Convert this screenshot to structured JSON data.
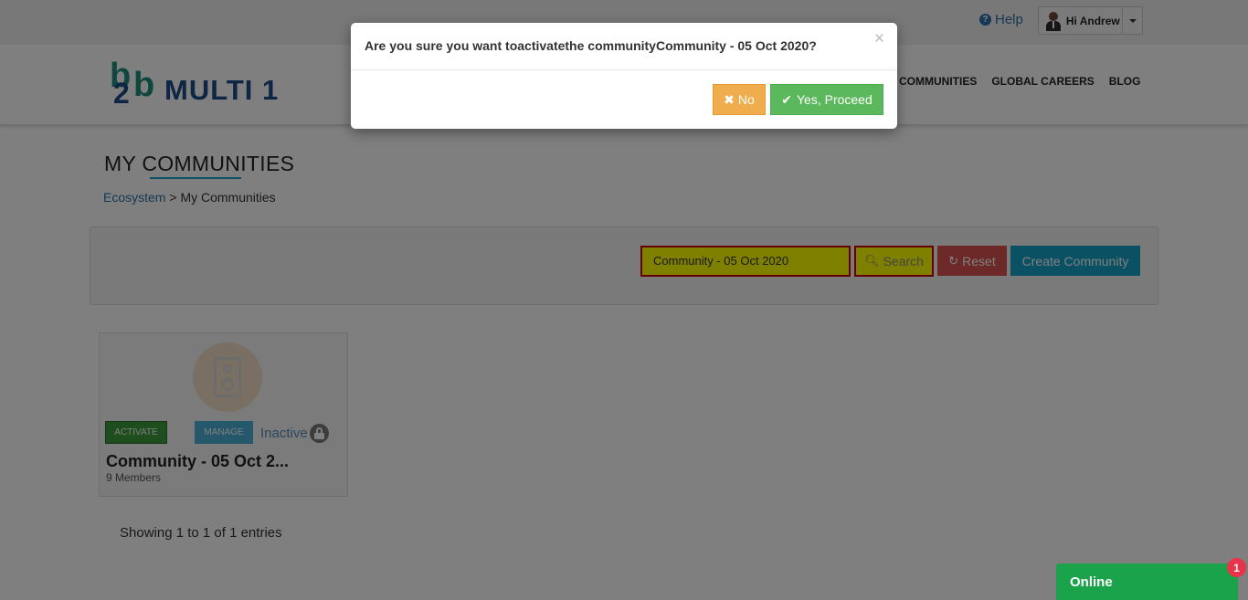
{
  "topbar": {
    "help_label": "Help",
    "help_icon": "question-circle-icon",
    "user_greeting": "Hi Andrew"
  },
  "header": {
    "logo_mark_b": "b",
    "logo_mark_2": "2",
    "logo_mark_b2": "b",
    "logo_text": "MULTI 1",
    "nav": [
      "COMMUNITIES",
      "GLOBAL CAREERS",
      "BLOG"
    ]
  },
  "page": {
    "title": "MY COMMUNITIES",
    "breadcrumb_root": "Ecosystem",
    "breadcrumb_separator": ">",
    "breadcrumb_current": "My Communities"
  },
  "search": {
    "value": "Community - 05 Oct 2020",
    "search_label": "Search",
    "reset_label": "Reset",
    "create_label": "Create Community"
  },
  "card": {
    "activate_label": "ACTIVATE",
    "manage_label": "MANAGE",
    "status": "Inactive",
    "name": "Community - 05 Oct 2...",
    "members": "9 Members"
  },
  "footer": {
    "entries": "Showing 1 to 1 of 1 entries"
  },
  "modal": {
    "title": "Are you sure you want toactivatethe communityCommunity - 05 Oct 2020?",
    "close_glyph": "×",
    "no_label": "No",
    "yes_label": "Yes, Proceed"
  },
  "chat": {
    "label": "Online",
    "badge": "1"
  },
  "colors": {
    "accent": "#17a2c8",
    "brand_green": "#1e8f7e",
    "brand_blue": "#1c4c88",
    "warning": "#f0ad4e",
    "success": "#5cb85c",
    "danger": "#d9534f"
  }
}
